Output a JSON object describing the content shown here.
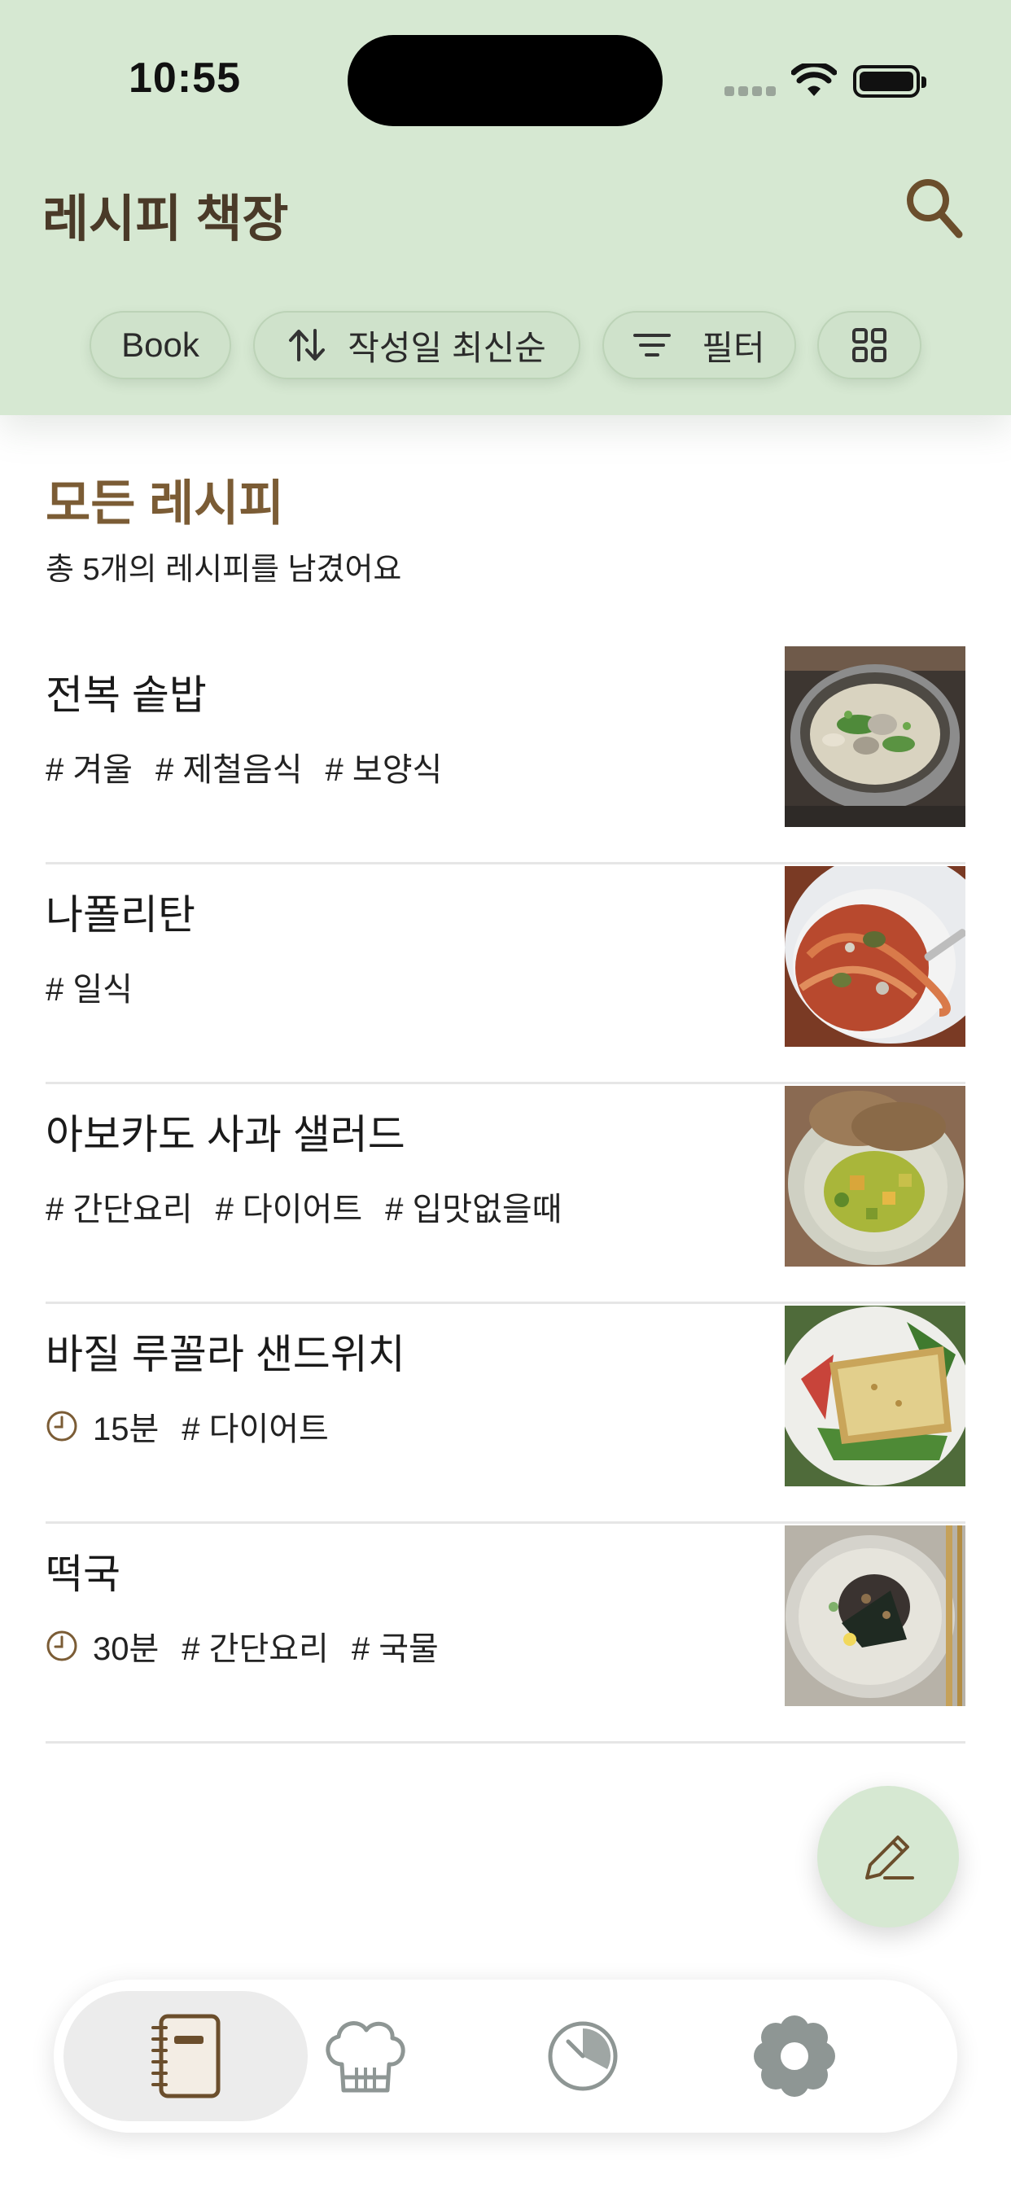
{
  "status_bar": {
    "time": "10:55"
  },
  "header": {
    "title": "레시피 책장"
  },
  "chips": [
    {
      "label": "Book"
    },
    {
      "label": "작성일 최신순"
    },
    {
      "label": "필터"
    }
  ],
  "section": {
    "title": "모든 레시피",
    "subtitle": "총 5개의 레시피를 남겼어요"
  },
  "recipes": [
    {
      "name": "전복 솥밥",
      "time": "",
      "tags": [
        "# 겨울",
        "# 제철음식",
        "# 보양식"
      ]
    },
    {
      "name": "나폴리탄",
      "time": "",
      "tags": [
        "# 일식"
      ]
    },
    {
      "name": "아보카도 사과 샐러드",
      "time": "",
      "tags": [
        "# 간단요리",
        "# 다이어트",
        "# 입맛없을때"
      ]
    },
    {
      "name": "바질 루꼴라 샌드위치",
      "time": "15분",
      "tags": [
        "# 다이어트"
      ]
    },
    {
      "name": "떡국",
      "time": "30분",
      "tags": [
        "# 간단요리",
        "# 국물"
      ]
    }
  ],
  "icons": {
    "search": "search-icon",
    "sort": "sort-arrows-icon",
    "filter": "filter-lines-icon",
    "grid": "grid-view-icon",
    "clock": "clock-icon",
    "edit": "pencil-icon",
    "tab_book": "recipe-book-icon",
    "tab_chef": "chef-hat-icon",
    "tab_timer": "timer-icon",
    "tab_settings": "settings-flower-icon"
  },
  "colors": {
    "header_bg": "#d6e8d2",
    "brand_brown": "#7b5c35",
    "title_brown": "#4a3a28"
  }
}
